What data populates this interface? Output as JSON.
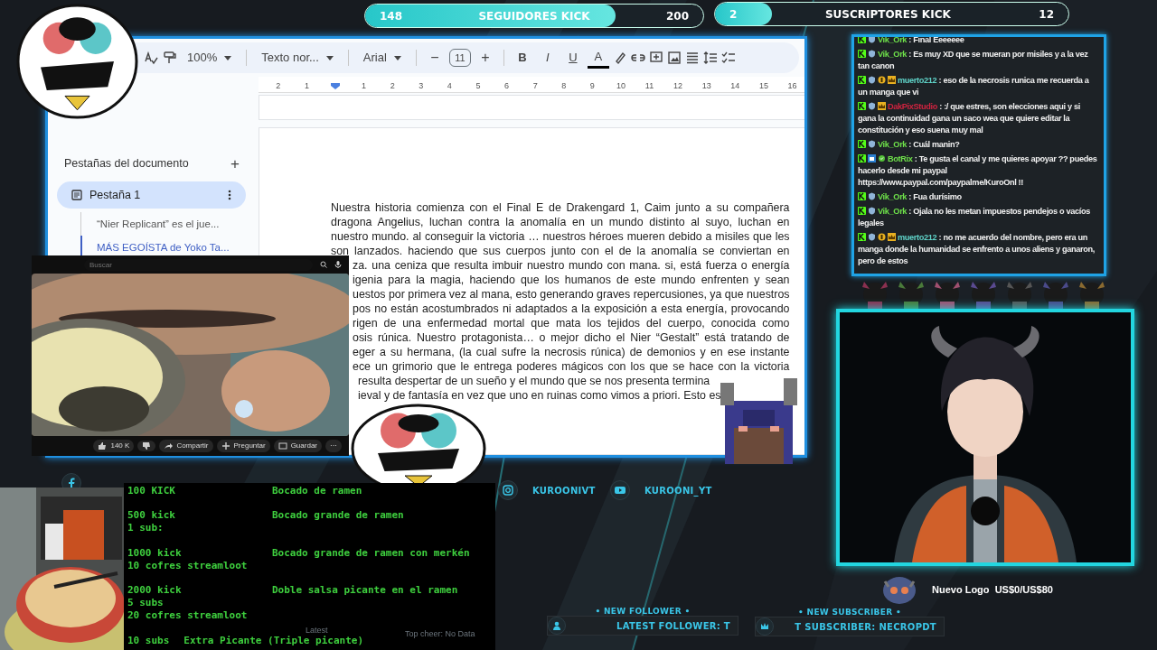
{
  "goals": [
    {
      "current": "148",
      "title": "SEGUIDORES KICK",
      "target": "200",
      "level": 0.74
    },
    {
      "current": "2",
      "title": "SUSCRIPTORES KICK",
      "target": "12",
      "level": 0.16
    }
  ],
  "document": {
    "toolbar": [
      {
        "kind": "dropdown",
        "label": "100%"
      },
      {
        "kind": "dropdown",
        "label": "Texto nor..."
      },
      {
        "kind": "dropdown",
        "label": "Arial"
      },
      {
        "kind": "button",
        "label": "−"
      },
      {
        "kind": "field",
        "label": "11"
      },
      {
        "kind": "button",
        "label": "+"
      },
      {
        "kind": "bold",
        "label": "B"
      },
      {
        "kind": "italic",
        "label": "I"
      },
      {
        "kind": "underline",
        "label": "U"
      },
      {
        "kind": "text_color",
        "label": "A",
        "color": "#000000"
      }
    ],
    "ruler": {
      "before_indent": [
        "2",
        "1"
      ],
      "after_indent": [
        "1",
        "2",
        "3",
        "4",
        "5",
        "6",
        "7",
        "8",
        "9",
        "10",
        "11",
        "12",
        "13",
        "14",
        "15",
        "16"
      ]
    },
    "sidebar": {
      "title": "Pestañas del documento",
      "add": "+",
      "tabs": [
        {
          "label": "Pestaña 1",
          "selected": true,
          "headings": [
            {
              "text": "“Nier Replicant” es el jue...",
              "selected": false
            },
            {
              "text": "MÁS EGOÍSTA de Yoko Ta...",
              "selected": true
            }
          ]
        }
      ]
    },
    "lines": [
      {
        "kind": "full",
        "text": "Nuestra historia comienza con el Final E de Drakengard 1, Caim junto a su compañera"
      },
      {
        "kind": "full",
        "text": "dragona Angelius, luchan contra la anomalía en un mundo distinto al suyo, luchan en"
      },
      {
        "kind": "full",
        "text": "nuestro mundo.  al conseguir la victoria … nuestros héroes mueren debido a misiles que les"
      },
      {
        "kind": "full",
        "text": "son lanzados. haciendo que sus cuerpos junto con el de la anomalía se conviertan en"
      },
      {
        "kind": "cut_left",
        "text": "za. una ceniza que resulta imbuir nuestro mundo con mana. si, está fuerza o energía"
      },
      {
        "kind": "cut_left",
        "text": "igenia para la magia, haciendo que los humanos de este mundo enfrenten y sean"
      },
      {
        "kind": "cut_left",
        "text": "uestos por primera vez al mana, esto generando graves repercusiones, ya que nuestros"
      },
      {
        "kind": "cut_left",
        "text": "pos no están acostumbrados ni adaptados a la exposición a esta energía, provocando"
      },
      {
        "kind": "cut_left",
        "text": "rigen de una enfermedad mortal que mata los tejidos del cuerpo, conocida como"
      },
      {
        "kind": "cut_left",
        "text": "osis rúnica. Nuestro protagonista… o mejor dicho el Nier “Gestalt” está tratando de"
      },
      {
        "kind": "cut_left",
        "text": "eger a su hermana, (la cual sufre la necrosis rúnica) de demonios y en ese instante"
      },
      {
        "kind": "cut_left",
        "text": "ece un grimorio que le entrega poderes mágicos con los que se hace con la victoria"
      },
      {
        "kind": "cut_both",
        "text": "resulta despertar de un sueño y el mundo que se nos presenta termina"
      },
      {
        "kind": "cut_both",
        "text": "ieval y de fantasía en vez que uno en ruinas como vimos a priori. Esto es"
      }
    ]
  },
  "video": {
    "search_placeholder": "Buscar",
    "actions": [
      {
        "kind": "like",
        "label": "140 K"
      },
      {
        "kind": "dislike"
      },
      {
        "kind": "share",
        "label": "Compartir"
      },
      {
        "kind": "ask",
        "label": "Preguntar"
      },
      {
        "kind": "save",
        "label": "Guardar"
      },
      {
        "kind": "more",
        "label": "···"
      }
    ]
  },
  "chat": [
    {
      "bot": false,
      "gifter": false,
      "subscriber": false,
      "user": "Vik_Ork",
      "color": "#6ee04a",
      "text": ": Final Eeeeeee"
    },
    {
      "bot": false,
      "gifter": false,
      "subscriber": false,
      "user": "Vik_Ork",
      "color": "#6ee04a",
      "text": ": Es muy XD que se mueran por misiles y a la vez tan canon"
    },
    {
      "bot": false,
      "gifter": true,
      "subscriber": true,
      "user": "muerto212",
      "color": "#5fd3c8",
      "text": ": eso de la necrosis runica me recuerda a un manga que vi"
    },
    {
      "bot": false,
      "gifter": false,
      "subscriber": true,
      "user": "DakPixStudio",
      "color": "#d0233f",
      "text": ": :/ que estres, son elecciones aqui y si gana la continuidad gana un saco wea que quiere editar la constitución y eso suena muy mal"
    },
    {
      "bot": false,
      "gifter": false,
      "subscriber": false,
      "user": "Vik_Ork",
      "color": "#6ee04a",
      "text": ": Cuál manin?"
    },
    {
      "bot": true,
      "gifter": false,
      "subscriber": false,
      "user": "BotRix",
      "color": "#6ee04a",
      "text": ": Te gusta el canal y me quieres apoyar ?? puedes hacerlo desde mi paypal https://www.paypal.com/paypalme/KuroOnl !!"
    },
    {
      "bot": false,
      "gifter": false,
      "subscriber": false,
      "user": "Vik_Ork",
      "color": "#6ee04a",
      "text": ": Fua durísimo"
    },
    {
      "bot": false,
      "gifter": false,
      "subscriber": false,
      "user": "Vik_Ork",
      "color": "#6ee04a",
      "text": ": Ojala no les metan impuestos pendejos o vacíos legales"
    },
    {
      "bot": false,
      "gifter": true,
      "subscriber": true,
      "user": "muerto212",
      "color": "#5fd3c8",
      "text": ": no me acuerdo del nombre, pero era un manga donde la humanidad se enfrento a unos aliens y ganaron, pero de estos"
    }
  ],
  "goal_widget": {
    "text": "Nuevo Logo  US$0/US$80"
  },
  "socials": [
    {
      "kind": "instagram",
      "handle": "KUROONIVT"
    },
    {
      "kind": "youtube",
      "handle": "KUROONI_YT"
    }
  ],
  "rewards": [
    {
      "kind": "columns",
      "requirements": [
        "100 KICK"
      ],
      "reward": "Bocado de ramen"
    },
    {
      "kind": "columns",
      "requirements": [
        "500 kick",
        "1 sub:"
      ],
      "reward": "Bocado grande de ramen"
    },
    {
      "kind": "columns",
      "requirements": [
        "1000 kick",
        "10 cofres streamloot"
      ],
      "reward": "Bocado grande de ramen con merkén"
    },
    {
      "kind": "columns",
      "requirements": [
        "2000 kick",
        "5 subs",
        "20 cofres streamloot"
      ],
      "reward": "Doble salsa picante en el ramen"
    },
    {
      "kind": "inline",
      "requirements": [
        "10 subs"
      ],
      "reward": "Extra Picante (Triple picante)"
    }
  ],
  "donations": {
    "latest": "Latest",
    "top_cheer": "Top cheer: No Data"
  },
  "alerts": [
    {
      "kind": "follower",
      "title": "• NEW FOLLOWER •",
      "text": "LATEST FOLLOWER: T"
    },
    {
      "kind": "subscriber",
      "title": "• NEW SUBSCRIBER •",
      "text": "T SUBSCRIBER: NECROPDT"
    }
  ]
}
